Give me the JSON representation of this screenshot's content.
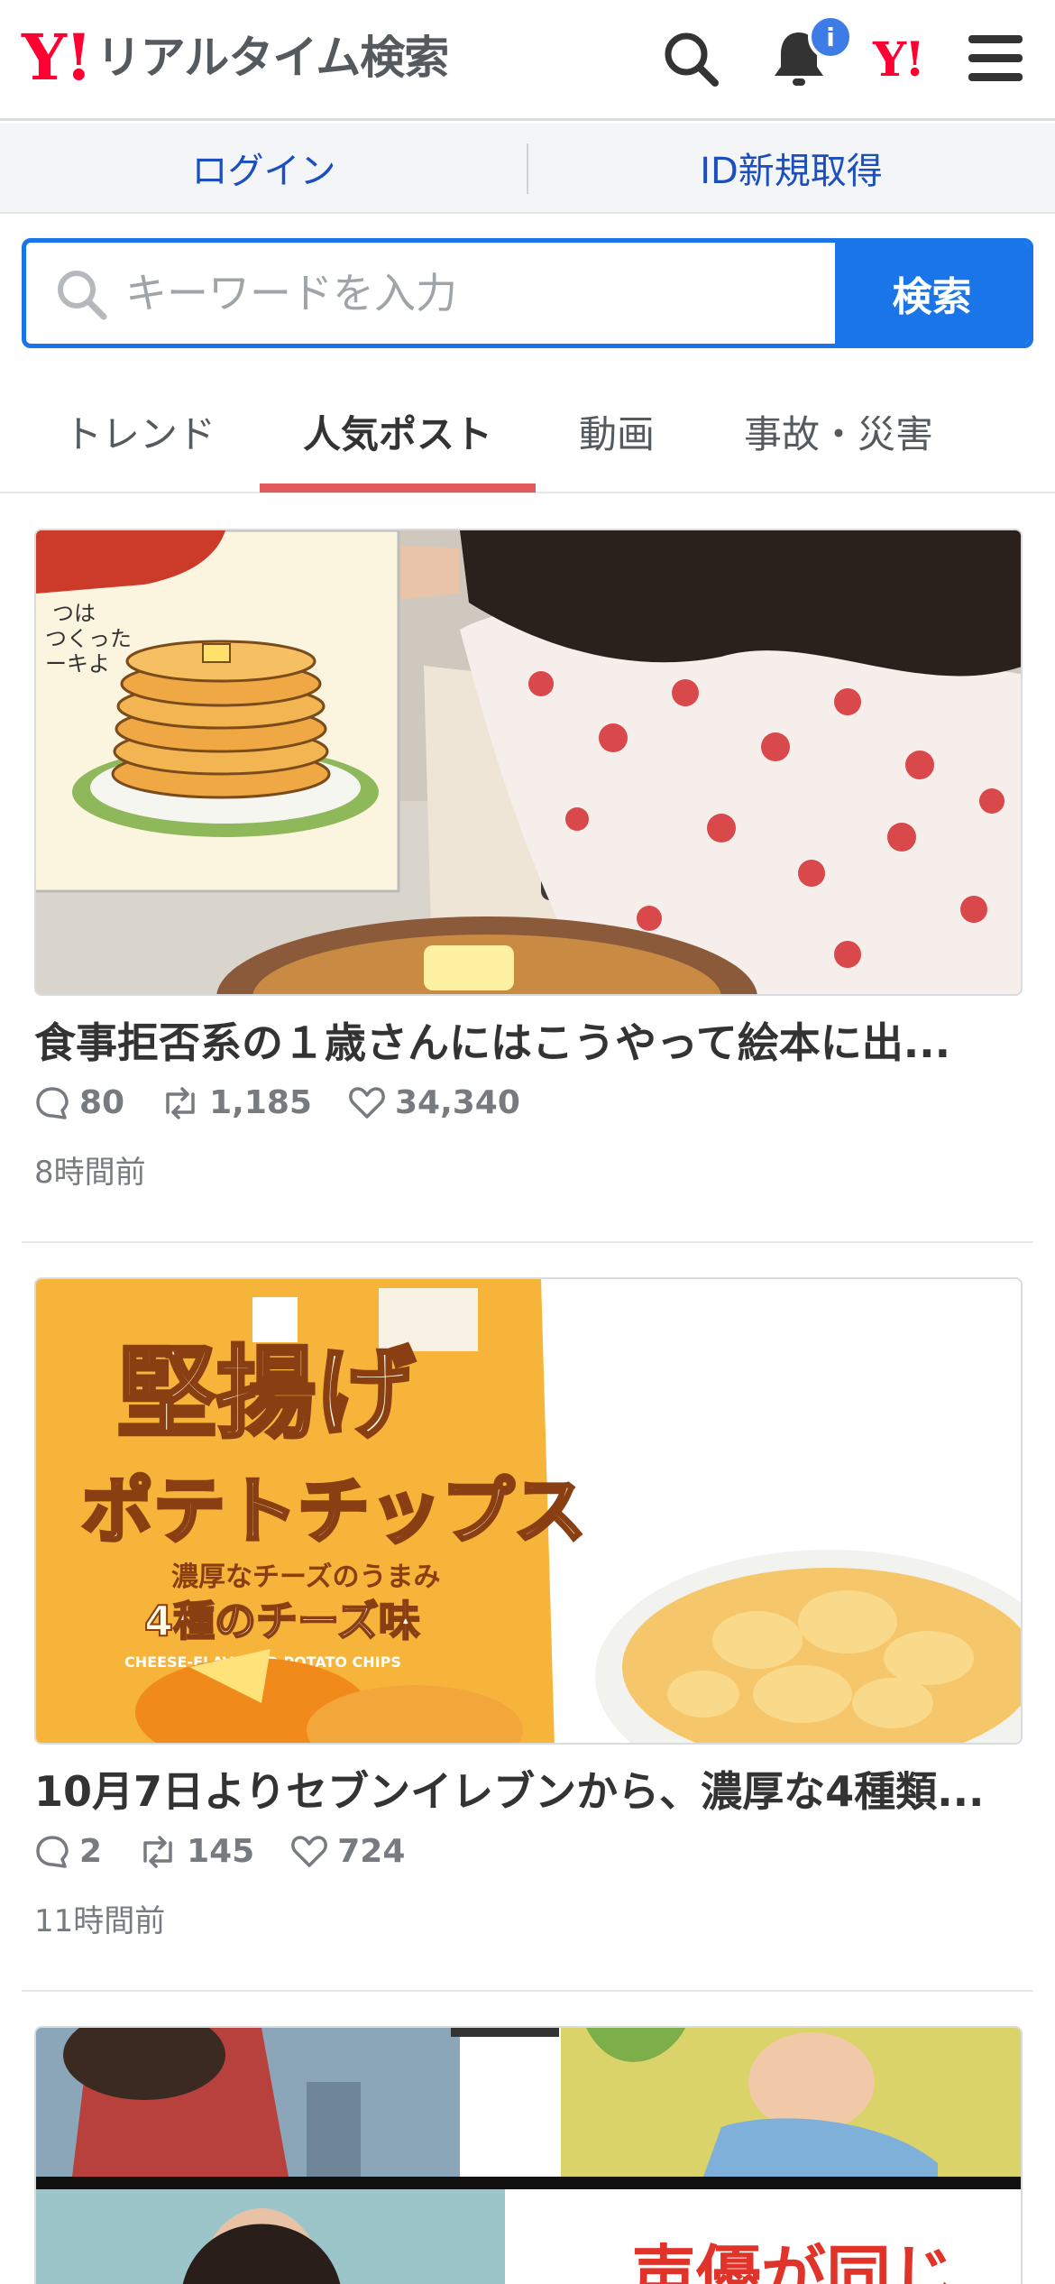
{
  "header": {
    "logo_mark": "Y!",
    "logo_text": "リアルタイム検索",
    "notification_badge": "i",
    "yj_mark": "Y!"
  },
  "auth": {
    "login": "ログイン",
    "register": "ID新規取得"
  },
  "search": {
    "placeholder": "キーワードを入力",
    "button": "検索"
  },
  "tabs": [
    {
      "label": "トレンド",
      "active": false
    },
    {
      "label": "人気ポスト",
      "active": true
    },
    {
      "label": "動画",
      "active": false
    },
    {
      "label": "事故・災害",
      "active": false
    }
  ],
  "posts": [
    {
      "title": "食事拒否系の１歳さんにはこうやって絵本に出...",
      "replies": "80",
      "reposts": "1,185",
      "likes": "34,340",
      "time": "8時間前",
      "image": {
        "book_text_1": "つは",
        "book_text_2": "つくった",
        "book_text_3": "ーキよ"
      }
    },
    {
      "title": "10月7日よりセブンイレブンから、濃厚な4種類...",
      "replies": "2",
      "reposts": "145",
      "likes": "724",
      "time": "11時間前",
      "image": {
        "title_line_1": "堅揚げ",
        "title_line_2": "ポテトチップス",
        "sub_1": "濃厚なチーズのうまみ",
        "sub_2": "4種のチーズ味",
        "sub_3": "CHEESE-FLAVORED POTATO CHIPS"
      }
    },
    {
      "image": {
        "caption": "声優が同じ"
      }
    }
  ],
  "colors": {
    "brand_red": "#ff0033",
    "accent_blue": "#1a75e8",
    "link_blue": "#1a4fbd",
    "tab_underline": "#e25a5a",
    "badge_blue": "#3d7be6"
  },
  "icons": [
    "search-icon",
    "bell-icon",
    "menu-icon",
    "reply-icon",
    "repost-icon",
    "like-icon"
  ]
}
